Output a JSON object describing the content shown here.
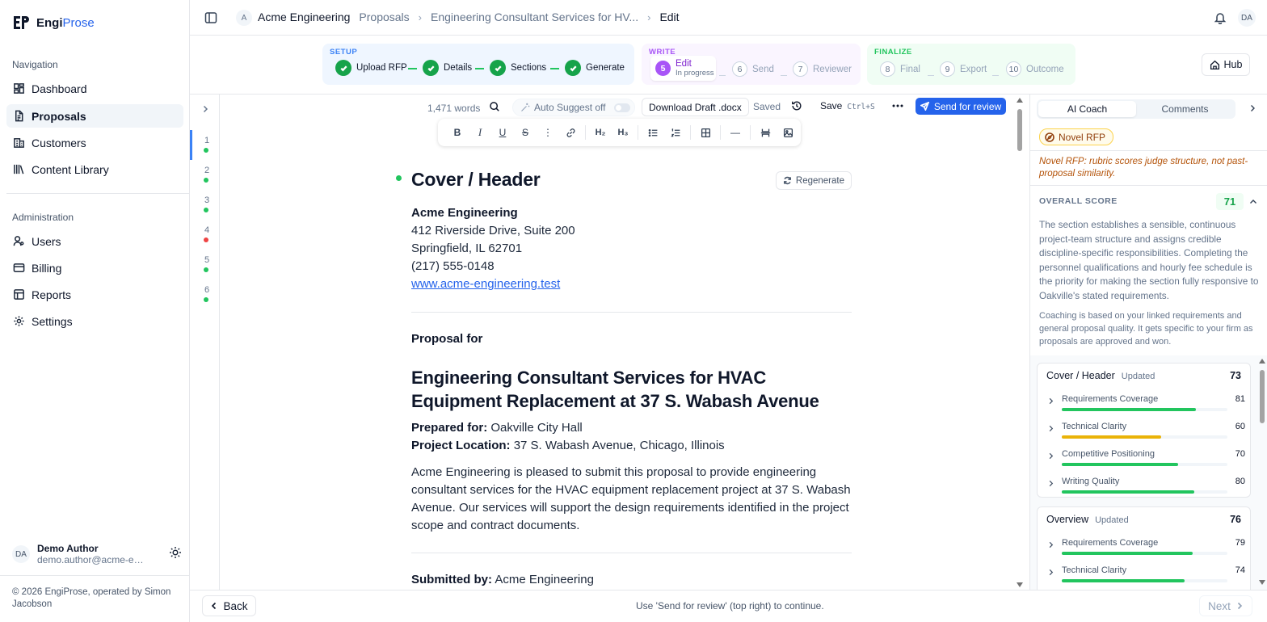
{
  "brand": {
    "part1": "Engi",
    "part2": "Prose"
  },
  "sidebar": {
    "nav_label": "Navigation",
    "nav_items": [
      {
        "label": "Dashboard",
        "icon": "dashboard-icon"
      },
      {
        "label": "Proposals",
        "icon": "document-icon",
        "active": true
      },
      {
        "label": "Customers",
        "icon": "building-icon"
      },
      {
        "label": "Content Library",
        "icon": "library-icon"
      }
    ],
    "admin_label": "Administration",
    "admin_items": [
      {
        "label": "Users",
        "icon": "users-icon"
      },
      {
        "label": "Billing",
        "icon": "credit-card-icon"
      },
      {
        "label": "Reports",
        "icon": "report-icon"
      },
      {
        "label": "Settings",
        "icon": "gear-icon"
      }
    ],
    "user": {
      "initials": "DA",
      "name": "Demo Author",
      "email": "demo.author@acme-engi..."
    },
    "copyright": "© 2026 EngiProse, operated by Simon Jacobson"
  },
  "topbar": {
    "org_initial": "A",
    "breadcrumbs": [
      "Acme Engineering",
      "Proposals",
      "Engineering Consultant Services for HV...",
      "Edit"
    ],
    "user_initials": "DA"
  },
  "stepper": {
    "setup": {
      "title": "SETUP",
      "steps": [
        "Upload RFP",
        "Details",
        "Sections",
        "Generate"
      ]
    },
    "write": {
      "title": "WRITE",
      "current": {
        "num": "5",
        "label": "Edit",
        "status": "In progress"
      },
      "steps": [
        {
          "num": "6",
          "label": "Send"
        },
        {
          "num": "7",
          "label": "Reviewer"
        }
      ]
    },
    "finalize": {
      "title": "FINALIZE",
      "steps": [
        {
          "num": "8",
          "label": "Final"
        },
        {
          "num": "9",
          "label": "Export"
        },
        {
          "num": "10",
          "label": "Outcome"
        }
      ]
    },
    "hub_label": "Hub"
  },
  "outline": {
    "items": [
      {
        "num": "1",
        "status": "#22c55e"
      },
      {
        "num": "2",
        "status": "#22c55e"
      },
      {
        "num": "3",
        "status": "#22c55e"
      },
      {
        "num": "4",
        "status": "#ef4444"
      },
      {
        "num": "5",
        "status": "#22c55e"
      },
      {
        "num": "6",
        "status": "#22c55e"
      }
    ]
  },
  "editor": {
    "word_count": "1,471 words",
    "auto_suggest": "Auto Suggest off",
    "download": "Download Draft .docx",
    "saved": "Saved",
    "save": "Save",
    "save_shortcut": "Ctrl+S",
    "send": "Send for review",
    "format_buttons": [
      "B",
      "I",
      "U",
      "S",
      "⋮",
      "link",
      "H₂",
      "H₃",
      "bullet-list",
      "numbered-list",
      "table",
      "—",
      "split",
      "image"
    ]
  },
  "doc": {
    "section_title": "Cover / Header",
    "regenerate": "Regenerate",
    "company": "Acme Engineering",
    "address1": "412 Riverside Drive, Suite 200",
    "address2": "Springfield, IL 62701",
    "phone": "(217) 555-0148",
    "website": "www.acme-engineering.test",
    "proposal_for": "Proposal for",
    "title": "Engineering Consultant Services for HVAC Equipment Replacement at 37 S. Wabash Avenue",
    "prepared_for_label": "Prepared for:",
    "prepared_for": "Oakville City Hall",
    "location_label": "Project Location:",
    "location": "37 S. Wabash Avenue, Chicago, Illinois",
    "paragraph": "Acme Engineering is pleased to submit this proposal to provide engineering consultant services for the HVAC equipment replacement project at 37 S. Wabash Avenue. Our services will support the design requirements identified in the project scope and contract documents.",
    "submitted_label": "Submitted by:",
    "submitted": "Acme Engineering"
  },
  "coach": {
    "tabs": [
      "AI Coach",
      "Comments"
    ],
    "badge": "Novel RFP",
    "note": "Novel RFP: rubric scores judge structure, not past-proposal similarity.",
    "overall_label": "OVERALL SCORE",
    "overall_score": "71",
    "summary": "The section establishes a sensible, continuous project-team structure and assigns credible discipline-specific responsibilities. Completing the personnel qualifications and hourly fee schedule is the priority for making the section fully responsive to Oakville's stated requirements.",
    "coaching_note": "Coaching is based on your linked requirements and general proposal quality. It gets specific to your firm as proposals are approved and won.",
    "cards": [
      {
        "title": "Cover / Header",
        "status": "Updated",
        "score": "73",
        "metrics": [
          {
            "label": "Requirements Coverage",
            "value": 81,
            "color": "#22c55e"
          },
          {
            "label": "Technical Clarity",
            "value": 60,
            "color": "#eab308"
          },
          {
            "label": "Competitive Positioning",
            "value": 70,
            "color": "#22c55e"
          },
          {
            "label": "Writing Quality",
            "value": 80,
            "color": "#22c55e"
          }
        ]
      },
      {
        "title": "Overview",
        "status": "Updated",
        "score": "76",
        "metrics": [
          {
            "label": "Requirements Coverage",
            "value": 79,
            "color": "#22c55e"
          },
          {
            "label": "Technical Clarity",
            "value": 74,
            "color": "#22c55e"
          }
        ]
      }
    ]
  },
  "bottom": {
    "back": "Back",
    "hint": "Use 'Send for review' (top right) to continue.",
    "next": "Next"
  }
}
